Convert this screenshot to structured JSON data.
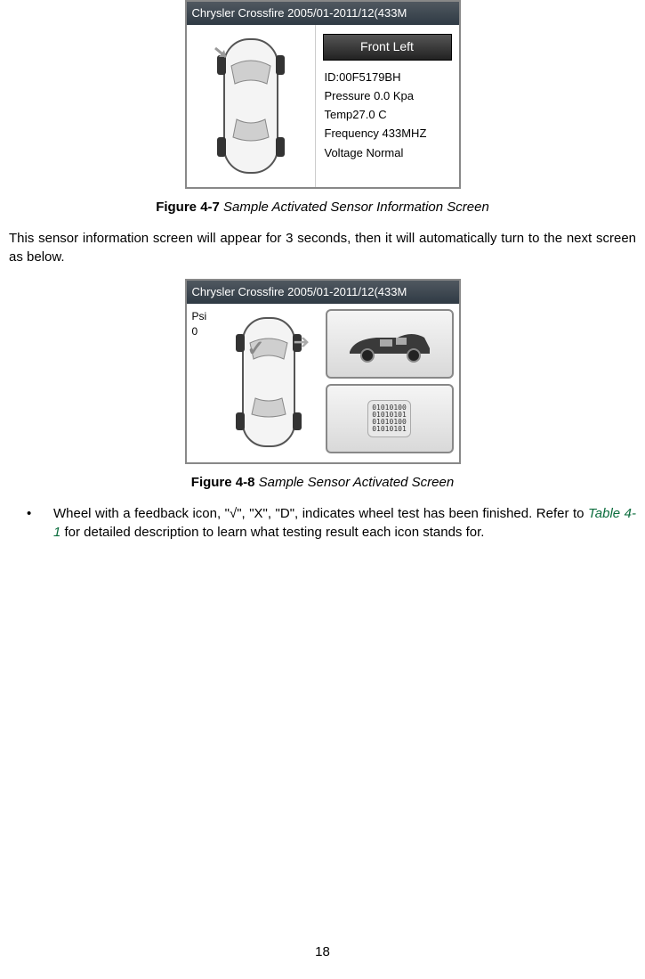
{
  "fig47": {
    "device_title": "Chrysler Crossfire 2005/01-2011/12(433M",
    "badge": "Front Left",
    "sensor": {
      "id": "ID:00F5179BH",
      "pressure": "Pressure 0.0 Kpa",
      "temp": "Temp27.0 C",
      "freq": "Frequency 433MHZ",
      "voltage": "Voltage Normal"
    },
    "caption_num": "Figure 4-7",
    "caption_title": " Sample Activated Sensor Information Screen"
  },
  "para1": "This sensor information screen will appear for 3 seconds, then it will automatically turn to the next screen as below.",
  "fig48": {
    "device_title": "Chrysler Crossfire 2005/01-2011/12(433M",
    "psi_label": "Psi",
    "psi_value": "0",
    "binary_text": "01010100\n01010101\n01010100\n01010101",
    "caption_num": "Figure 4-8",
    "caption_title": " Sample Sensor Activated Screen"
  },
  "bullet": {
    "text_before": "Wheel with a feedback icon, \"√\", \"X\", \"D\", indicates wheel test has been finished. Refer to ",
    "link": "Table 4-1",
    "text_after": " for detailed description to learn what testing result each icon stands for."
  },
  "page_number": "18"
}
